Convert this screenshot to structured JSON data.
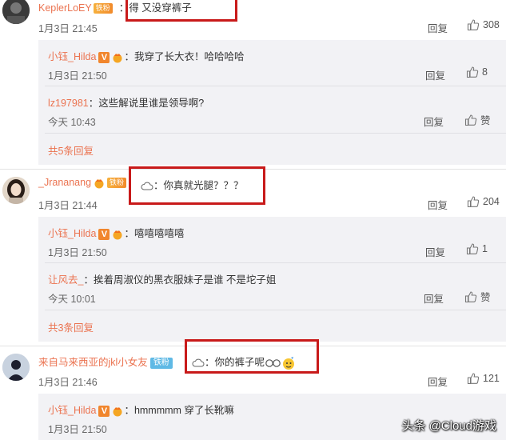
{
  "comments": [
    {
      "user": "KeplerLoEY",
      "badge": "铁粉",
      "text": "：得 又没穿裤子",
      "date": "1月3日 21:45",
      "reply_label": "回复",
      "likes": "308",
      "replies": [
        {
          "user": "小钰_Hilda",
          "text": "：我穿了长大衣！哈哈哈哈",
          "date": "1月3日 21:50",
          "reply_label": "回复",
          "likes": "8"
        },
        {
          "user": "lz197981",
          "text": "：这些解说里谁是领导啊?",
          "date": "今天 10:43",
          "reply_label": "回复",
          "likes": "赞"
        }
      ],
      "more": "共5条回复"
    },
    {
      "user": "_Jrananang",
      "badge": "铁粉",
      "text": "：你真就光腿？？？",
      "date": "1月3日 21:44",
      "reply_label": "回复",
      "likes": "204",
      "replies": [
        {
          "user": "小钰_Hilda",
          "text": "：嘻嘻嘻嘻嘻",
          "date": "1月3日 21:50",
          "reply_label": "回复",
          "likes": "1"
        },
        {
          "user": "让风去_",
          "text": "：挨着周淑仪的黑衣服妹子是谁 不是坨子姐",
          "date": "今天 10:01",
          "reply_label": "回复",
          "likes": "赞"
        }
      ],
      "more": "共3条回复"
    },
    {
      "user": "来自马来西亚的jkl小女友",
      "badge": "铁粉",
      "text": "：你的裤子呢",
      "date": "1月3日 21:46",
      "reply_label": "回复",
      "likes": "121",
      "replies": [
        {
          "user": "小钰_Hilda",
          "text": "：hmmmmm 穿了长靴嘛",
          "date": "1月3日 21:50",
          "reply_label": "回复",
          "likes": ""
        }
      ]
    }
  ],
  "watermark": "头条 @Cloud游戏",
  "colors": {
    "username": "#eb7350",
    "highlight_box": "#c81a1a",
    "panel": "#f2f2f5"
  }
}
